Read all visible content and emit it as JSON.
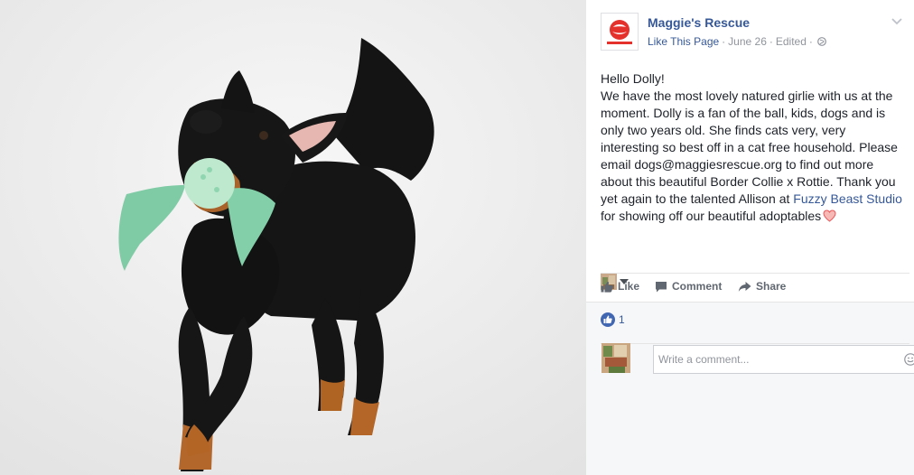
{
  "post": {
    "page_name": "Maggie's Rescue",
    "like_page": "Like This Page",
    "date": "June 26",
    "edited": "Edited",
    "body": {
      "line1": "Hello Dolly!",
      "main_text": "We have the most lovely natured girlie with us at the moment. Dolly is a fan of the ball, kids, dogs and is only two years old. She finds cats very, very interesting so best off in a cat free household. Please email dogs@maggiesrescue.org to find out more about this beautiful Border Collie x Rottie. Thank you yet again to the talented Allison at ",
      "link_text": "Fuzzy Beast Studio",
      "tail_text": " for showing off our beautiful adoptables"
    }
  },
  "actions": {
    "like": "Like",
    "comment": "Comment",
    "share": "Share"
  },
  "reactions": {
    "count": "1"
  },
  "comment_box": {
    "placeholder": "Write a comment..."
  },
  "icons": {
    "avatar": "maggies-rescue-logo",
    "globe": "globe-icon",
    "chevron": "chevron-down-icon",
    "heart": "heart-icon",
    "like": "thumbs-up-icon",
    "comment": "comment-icon",
    "share": "share-icon",
    "emoji": "smiley-icon"
  },
  "colors": {
    "link": "#365899",
    "muted": "#90949c",
    "action": "#606770",
    "brand_red": "#e4312b",
    "like_blue": "#4267b2"
  }
}
